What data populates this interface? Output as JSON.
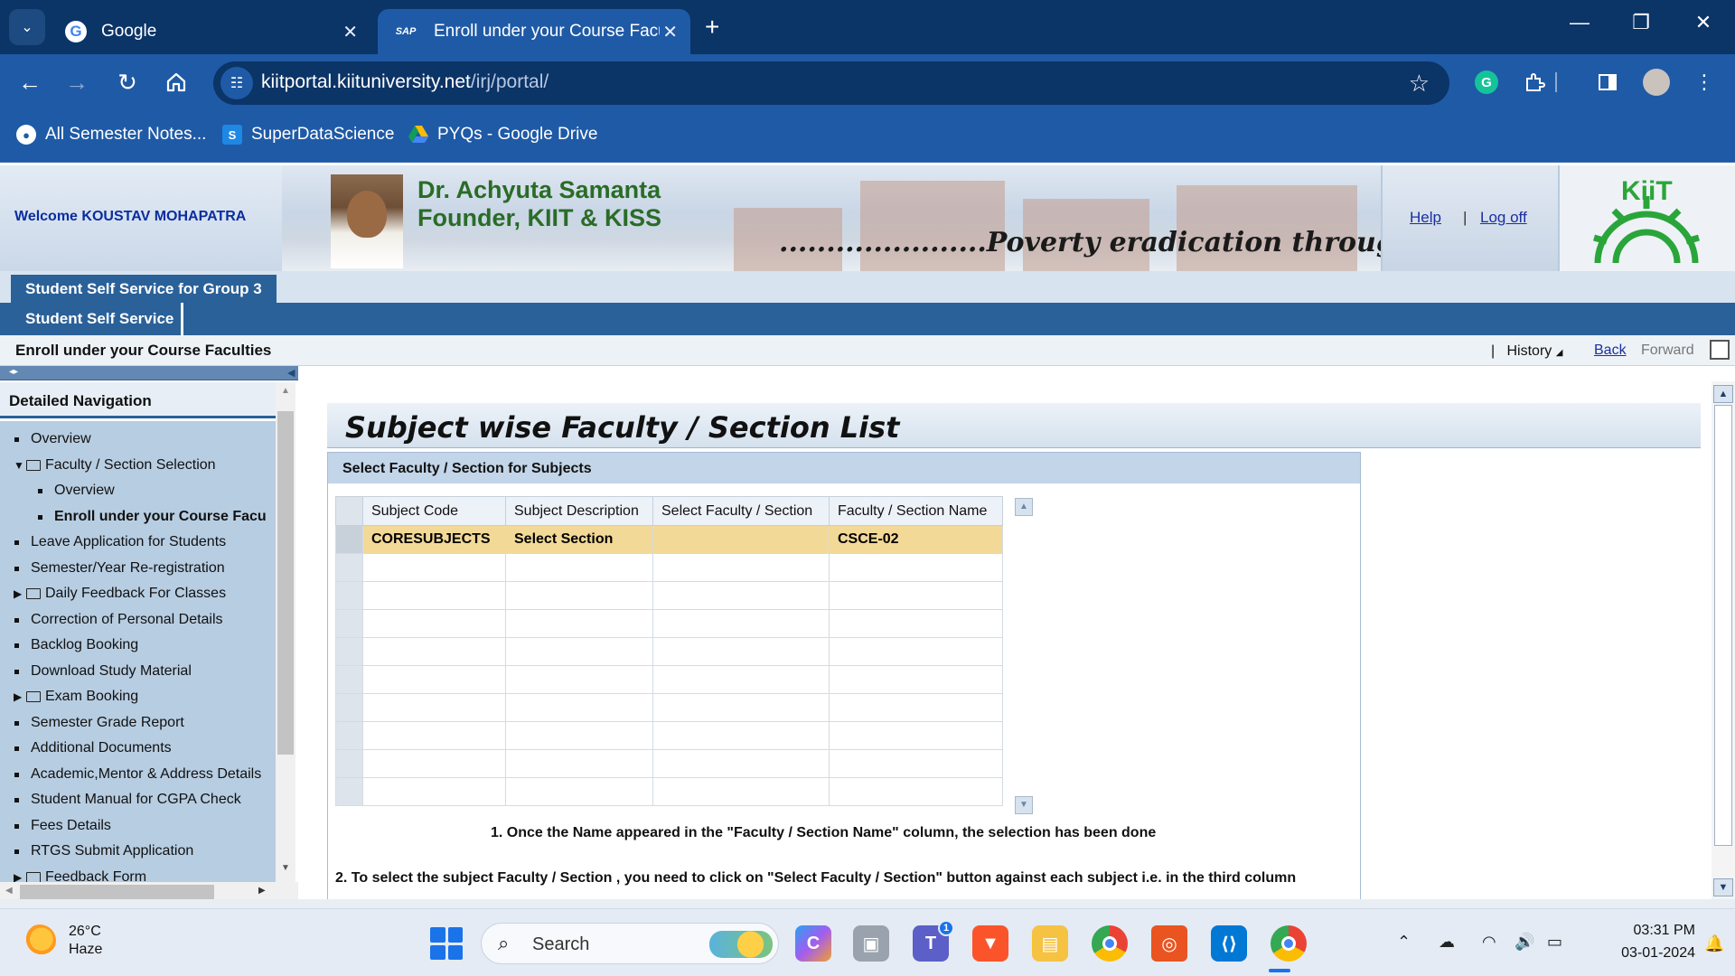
{
  "browser": {
    "tabs": [
      {
        "title": "Google",
        "favicon": "google-icon"
      },
      {
        "title": "Enroll under your Course Facult",
        "favicon": "sap-icon",
        "favicon_text": "SAP",
        "active": true
      }
    ],
    "url_host": "kiitportal.kiituniversity.net",
    "url_path": "/irj/portal/",
    "bookmarks": [
      {
        "label": "All Semester Notes...",
        "icon": "globe-icon"
      },
      {
        "label": "SuperDataScience",
        "icon": "superdatascience-icon",
        "icon_text": "S"
      },
      {
        "label": "PYQs - Google Drive",
        "icon": "google-drive-icon"
      }
    ],
    "accent_color": "#1f5aa6",
    "tabbar_color": "#0b3467"
  },
  "portal": {
    "welcome": "Welcome KOUSTAV MOHAPATRA",
    "founder_line1": "Dr. Achyuta Samanta",
    "founder_line2": "Founder, KIIT & KISS",
    "motto": "......................Poverty eradication through educa",
    "help": "Help",
    "separator": "|",
    "logoff": "Log off",
    "role_tab": "Student Self Service for Group 3",
    "sub_tab": "Student Self Service",
    "page_title": "Enroll under your Course Faculties",
    "history_sep": "|",
    "history": "History",
    "back": "Back",
    "forward": "Forward"
  },
  "nav": {
    "heading": "Detailed Navigation",
    "items": [
      {
        "label": "Overview",
        "type": "leaf",
        "level": 0
      },
      {
        "label": "Faculty / Section Selection",
        "type": "folder-open",
        "level": 0
      },
      {
        "label": "Overview",
        "type": "leaf",
        "level": 1
      },
      {
        "label": "Enroll under your Course Facu",
        "type": "leaf",
        "level": 1,
        "active": true
      },
      {
        "label": "Leave Application for Students",
        "type": "leaf",
        "level": 0
      },
      {
        "label": "Semester/Year Re-registration",
        "type": "leaf",
        "level": 0
      },
      {
        "label": "Daily Feedback For Classes",
        "type": "folder",
        "level": 0
      },
      {
        "label": "Correction of Personal Details",
        "type": "leaf",
        "level": 0
      },
      {
        "label": "Backlog Booking",
        "type": "leaf",
        "level": 0
      },
      {
        "label": "Download Study Material",
        "type": "leaf",
        "level": 0
      },
      {
        "label": "Exam Booking",
        "type": "folder",
        "level": 0
      },
      {
        "label": "Semester Grade Report",
        "type": "leaf",
        "level": 0
      },
      {
        "label": "Additional Documents",
        "type": "leaf",
        "level": 0
      },
      {
        "label": "Academic,Mentor & Address Details",
        "type": "leaf",
        "level": 0
      },
      {
        "label": "Student Manual for CGPA Check",
        "type": "leaf",
        "level": 0
      },
      {
        "label": "Fees Details",
        "type": "leaf",
        "level": 0
      },
      {
        "label": "RTGS Submit Application",
        "type": "leaf",
        "level": 0
      },
      {
        "label": "Feedback Form",
        "type": "folder",
        "level": 0
      }
    ]
  },
  "content": {
    "title": "Subject wise Faculty / Section List",
    "group_title": "Select Faculty / Section for Subjects",
    "columns": [
      "Subject Code",
      "Subject Description",
      "Select Faculty / Section",
      "Faculty / Section Name"
    ],
    "rows": [
      [
        "CORESUBJECTS",
        "Select Section",
        "",
        "CSCE-02"
      ]
    ],
    "empty_rows": 9,
    "note1": "1. Once the Name appeared in the \"Faculty / Section Name\" column, the selection has been done",
    "note2": "2. To select the subject Faculty / Section , you need to click on \"Select Faculty / Section\" button against each subject i.e. in the third column",
    "selected_row_color": "#f3d997"
  },
  "taskbar": {
    "weather_temp": "26°C",
    "weather_desc": "Haze",
    "search_placeholder": "Search",
    "teams_badge": "1",
    "apps": [
      "copilot-icon",
      "task-view-icon",
      "teams-icon",
      "brave-icon",
      "file-explorer-icon",
      "chrome-icon",
      "ubuntu-icon",
      "vscode-icon",
      "chrome-profile-icon"
    ],
    "time": "03:31 PM",
    "date": "03-01-2024"
  }
}
